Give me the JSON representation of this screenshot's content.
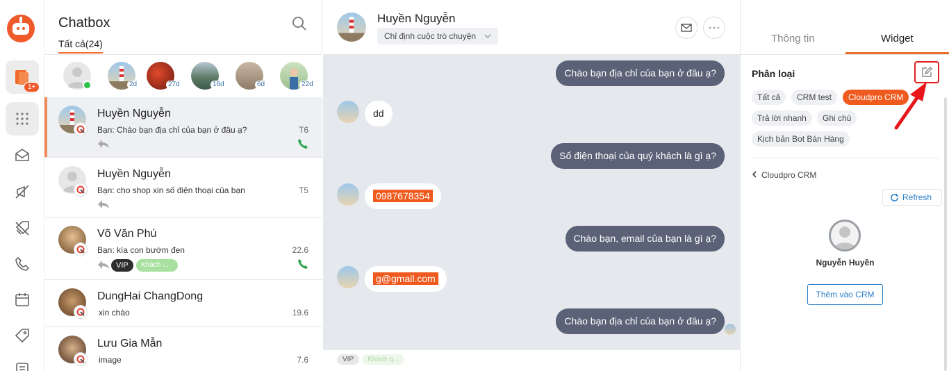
{
  "app": {
    "brand_color": "#ef5a2a",
    "accent": "#ef6c2b",
    "rail_badge": "1+"
  },
  "list": {
    "title": "Chatbox",
    "tab": "Tất cả(24)",
    "stories": [
      {
        "days": ""
      },
      {
        "days": "2d"
      },
      {
        "days": "27d"
      },
      {
        "days": "16d"
      },
      {
        "days": "6d"
      },
      {
        "days": "22d"
      }
    ],
    "conversations": [
      {
        "name": "Huyền Nguyễn",
        "msg": "Bạn: Chào bạn địa chỉ của bạn ở đâu ạ?",
        "time": "T6"
      },
      {
        "name": "Huyền Nguyễn",
        "msg": "Bạn: cho shop xin số điện thoại của bạn",
        "time": "T5"
      },
      {
        "name": "Võ Văn Phú",
        "msg": "Bạn: kìa con bướm đen",
        "time": "22.6",
        "tag_vip": "VIP",
        "tag_kh": "Khách ..."
      },
      {
        "name": "DungHai ChangDong",
        "msg": "xin chào",
        "time": "19.6"
      },
      {
        "name": "Lưu Gia Mẫn",
        "msg": "image",
        "time": "7.6"
      }
    ]
  },
  "chat": {
    "name": "Huyền Nguyễn",
    "assign": "Chỉ định cuộc trò chuyện",
    "messages": [
      {
        "dir": "out",
        "text": "Chào bạn địa chỉ của bạn ở đâu ạ?"
      },
      {
        "dir": "in",
        "text": "dd"
      },
      {
        "dir": "out",
        "text": "Số điện thoại của quý khách là gì ạ?"
      },
      {
        "dir": "in",
        "text": "0987678354"
      },
      {
        "dir": "out",
        "text": "Chào bạn, email của bạn là gì ạ?"
      },
      {
        "dir": "in",
        "text": "g@gmail.com"
      },
      {
        "dir": "out",
        "text": "Chào bạn địa chỉ của bạn ở đâu ạ?"
      }
    ],
    "footer_tags": {
      "vip": "VIP",
      "kh": "Khách q..."
    }
  },
  "panel": {
    "tabs": [
      "Thông tin",
      "Widget"
    ],
    "section": "Phân loại",
    "chips": [
      "Tất cả",
      "CRM test",
      "Cloudpro CRM",
      "Trả lời nhanh",
      "Ghi chú",
      "Kịch bản Bot Bán Hàng"
    ],
    "back": "Cloudpro CRM",
    "refresh": "Refresh",
    "customer_name": "Nguyễn Huyền",
    "add_crm": "Thêm vào CRM"
  }
}
